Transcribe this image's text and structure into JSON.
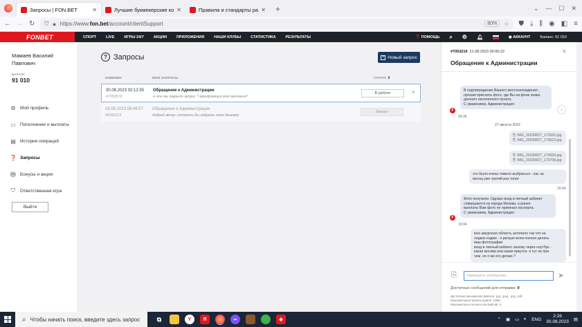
{
  "browser": {
    "tabs": [
      {
        "title": "Запросы | FON.BET",
        "active": true,
        "favicon_color": "#e0181e"
      },
      {
        "title": "Лучшие букмекерские конто",
        "active": false,
        "favicon_color": "#e0181e"
      },
      {
        "title": "Правила и стандарты работы",
        "active": false,
        "favicon_color": "#e0181e"
      }
    ],
    "url_prefix": "https://www.",
    "url_domain": "fon.bet",
    "url_path": "/account/clientSupport",
    "zoom": "80%"
  },
  "site": {
    "logo": "FONBET",
    "menu": [
      "СПОРТ",
      "LIVE",
      "ИГРЫ 24/7",
      "АКЦИИ",
      "ПРИЛОЖЕНИЯ",
      "НАШИ КЛУБЫ",
      "СТАТИСТИКА",
      "РЕЗУЛЬТАТЫ"
    ],
    "help": "ПОМОЩЬ",
    "account": "АККАУНТ",
    "balance": "Баланс: 91 010"
  },
  "user": {
    "name": "Мамаев Василий Павлович",
    "balance_label": "БАЛАНС",
    "balance_value": "91 010"
  },
  "sidebar": {
    "items": [
      {
        "label": "Мой профиль",
        "icon": "gear-icon"
      },
      {
        "label": "Пополнение и выплаты",
        "icon": "wallet-icon"
      },
      {
        "label": "История операций",
        "icon": "history-icon"
      },
      {
        "label": "Запросы",
        "icon": "question-icon",
        "active": true
      },
      {
        "label": "Бонусы и акции",
        "icon": "gift-icon"
      },
      {
        "label": "Ответственная игра",
        "icon": "shield-icon"
      }
    ],
    "exit": "Выйти"
  },
  "main": {
    "title": "Запросы",
    "new_request": "Новый запрос",
    "columns": {
      "changed": "ИЗМЕНЕН",
      "my_requests": "МОИ ЗАПРОСЫ",
      "status": "СТАТУС"
    },
    "rows": [
      {
        "date": "30.08.2023 02:12:35",
        "id": "#7053219",
        "subject": "Обращение к Администрации",
        "message": "а что вы закрыли запрос ? верификация моя окончена?",
        "status": "В работе"
      },
      {
        "date": "19.08.2023 08:46:57",
        "id": "#6341219",
        "subject": "Обращение к Администрации",
        "message": "добрый вечер ,хотелось бы забрать свою денежку",
        "status": "Закрыт"
      }
    ]
  },
  "chat": {
    "ticket_id": "#7053219",
    "ticket_date": "21.08.2023 00:00:22",
    "title": "Обращение к Администрации",
    "msg1": [
      "В подтверждение Вашего местонахождения ,",
      "просим прислать фото, где Вы на фоне знака",
      "данного населенного пункта.",
      "С уважением, Администрация"
    ],
    "time1": "09:36",
    "day": "27 августа 2023",
    "files": [
      "IMG_20230827_173552.jpg",
      "IMG_20230827_173623.jpg",
      "IMG_20230827_173659.jpg",
      "IMG_20230827_173708.jpg"
    ],
    "msg2": [
      "это было очень тяжело выбраться - нас за",
      "месяц уже третий раз топит"
    ],
    "time2": "16:44",
    "msg3": [
      "Фото получили. Однако вход в личный кабинет",
      "совершается из города Москва, а ранее",
      "выплаты Вам фото не оригинал паспорта.",
      "С уважением, Администрация"
    ],
    "time3": "19:04",
    "msg4": [
      "всю амурскую область затопило так что на",
      "лодках ездим - я рискую всем поехал делать",
      "ваш фотографии",
      "вход в личный кабинет захожу через ноутбук -",
      "какая москва или какая иркутск- я тут не при",
      "чем ,че я же его делаю ?"
    ],
    "input_placeholder": "Напишите сообщение",
    "available_label": "Доступных сообщений для отправки:",
    "available_count": "9",
    "hints": [
      "Доступные расширения файлов: .jpg, .jpeg, .png, .pdf,",
      "Максимальный размер файла: 10Mb,",
      "Максимальное количество файлов: 6"
    ]
  },
  "taskbar": {
    "search_placeholder": "Чтобы начать поиск, введите здесь запрос",
    "lang": "ENG",
    "time": "2:26",
    "date": "30.08.2023"
  }
}
